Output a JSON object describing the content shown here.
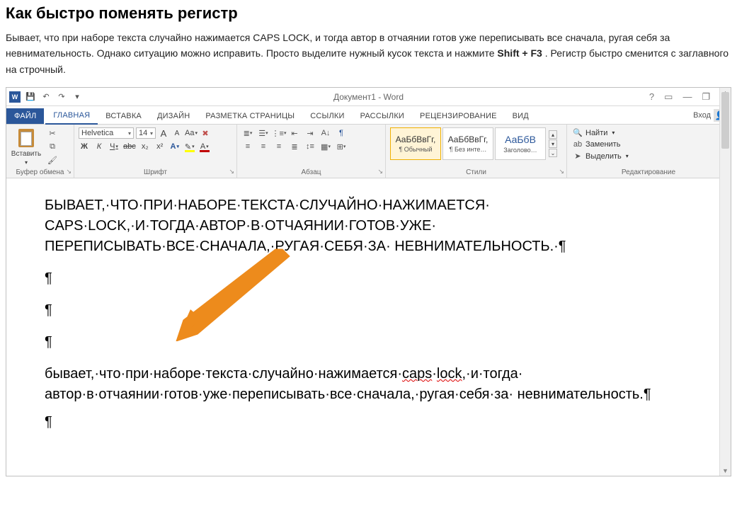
{
  "article": {
    "title": "Как быстро поменять регистр",
    "p1a": "Бывает, что при наборе текста случайно нажимается CAPS LOCK, и тогда автор в отчаянии готов уже переписывать все сначала, ругая себя за невнимательность. Однако ситуацию можно исправить. Просто выделите нужный кусок текста и нажмите ",
    "hotkey": "Shift + F3",
    "p1b": ". Регистр быстро сменится с заглавного на строчный."
  },
  "window": {
    "title": "Документ1 - Word",
    "help": "?",
    "ribbon_opts": "▭",
    "min": "—",
    "restore": "❐",
    "close": "✕",
    "signin": "Вход"
  },
  "qat": {
    "save_icon": "💾",
    "undo_icon": "↶",
    "redo_icon": "↷",
    "more": "▾"
  },
  "tabs": {
    "file": "ФАЙЛ",
    "home": "ГЛАВНАЯ",
    "insert": "ВСТАВКА",
    "design": "ДИЗАЙН",
    "layout": "РАЗМЕТКА СТРАНИЦЫ",
    "references": "ССЫЛКИ",
    "mailings": "РАССЫЛКИ",
    "review": "РЕЦЕНЗИРОВАНИЕ",
    "view": "ВИД"
  },
  "ribbon": {
    "clipboard": {
      "label": "Буфер обмена",
      "paste": "Вставить"
    },
    "font": {
      "label": "Шрифт",
      "name": "Helvetica",
      "size": "14",
      "grow": "A",
      "shrink": "A",
      "case": "Aa",
      "clear": "✖",
      "bold": "Ж",
      "italic": "К",
      "underline": "Ч",
      "strike": "abc",
      "sub": "x₂",
      "sup": "x²",
      "texteffects": "A",
      "highlight": "✎",
      "fontcolor": "A"
    },
    "paragraph": {
      "label": "Абзац",
      "pilcrow": "¶"
    },
    "styles": {
      "label": "Стили",
      "preview": "АаБбВвГг,",
      "heading_preview": "АаБбВ",
      "normal": "¶ Обычный",
      "nospace": "¶ Без инте…",
      "heading1": "Заголово…"
    },
    "editing": {
      "label": "Редактирование",
      "find": "Найти",
      "replace": "Заменить",
      "select": "Выделить"
    }
  },
  "doc": {
    "upper": "БЫВАЕТ,·ЧТО·ПРИ·НАБОРЕ·ТЕКСТА·СЛУЧАЙНО·НАЖИМАЕТСЯ· CAPS·LOCK,·И·ТОГДА·АВТОР·В·ОТЧАЯНИИ·ГОТОВ·УЖЕ· ПЕРЕПИСЫВАТЬ·ВСЕ·СНАЧАЛА,·РУГАЯ·СЕБЯ·ЗА· НЕВНИМАТЕЛЬНОСТЬ.·¶",
    "pil": "¶",
    "lower1": "бывает,·что·при·наборе·текста·случайно·нажимается·",
    "lower_caps": "caps",
    "lower_sp": "·",
    "lower_lock": "lock",
    "lower2": ",·и·тогда· автор·в·отчаянии·готов·уже·переписывать·все·сначала,·ругая·себя·за· невнимательность.¶"
  }
}
